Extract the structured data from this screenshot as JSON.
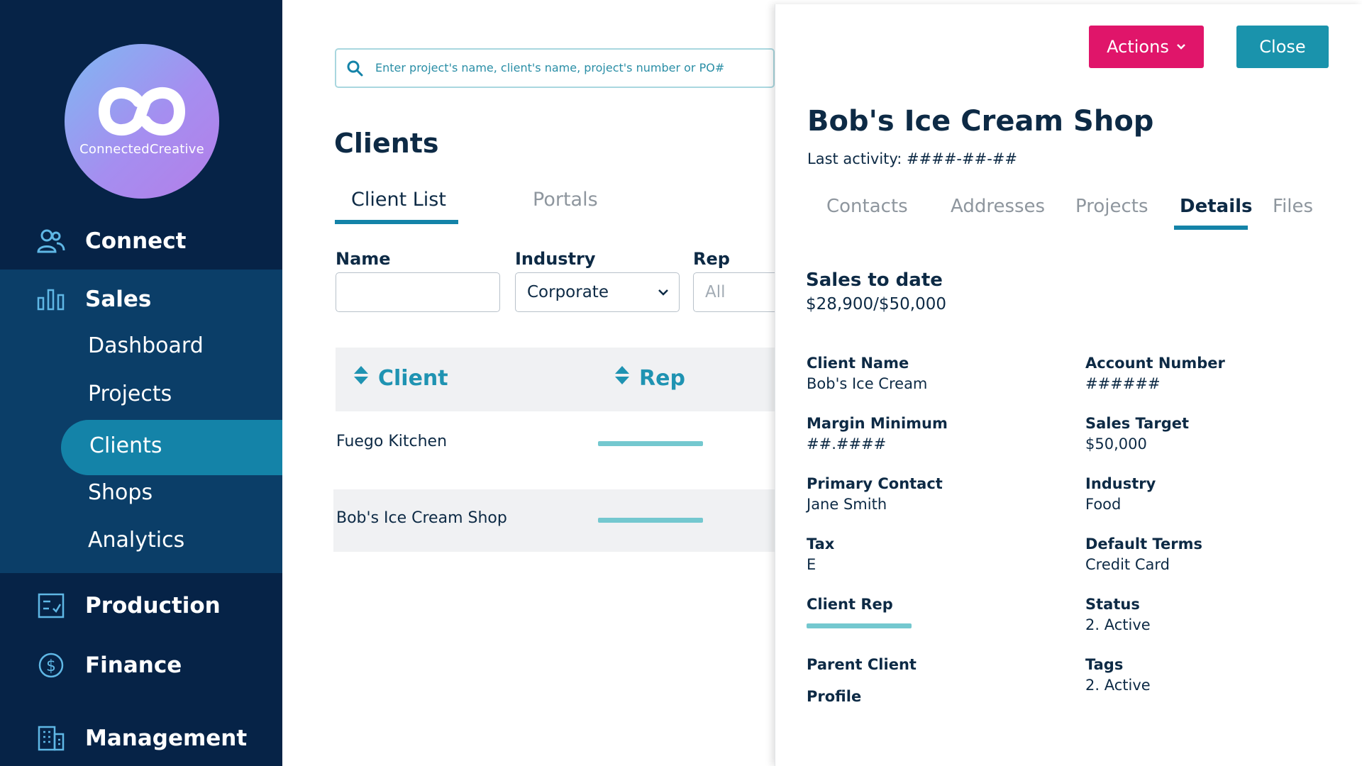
{
  "colors": {
    "sidebar_bg": "#062347",
    "sidebar_section_bg": "#0b3e68",
    "accent_teal": "#1483a8",
    "actions_pink": "#e0156a",
    "close_teal": "#1a93ac",
    "rep_bar": "#74c8cf"
  },
  "brand": {
    "name": "ConnectedCreative"
  },
  "sidebar": {
    "connect": "Connect",
    "sales": "Sales",
    "sales_items": [
      "Dashboard",
      "Projects",
      "Clients",
      "Shops",
      "Analytics"
    ],
    "active_item": "Clients",
    "production": "Production",
    "finance": "Finance",
    "management": "Management"
  },
  "search": {
    "placeholder": "Enter project's name, client's name, project's number or PO#"
  },
  "main": {
    "title": "Clients",
    "tabs": [
      "Client List",
      "Portals"
    ],
    "active_tab": "Client List",
    "filters": {
      "name_label": "Name",
      "name_value": "",
      "industry_label": "Industry",
      "industry_value": "Corporate",
      "rep_label": "Rep",
      "rep_value": "All"
    },
    "table": {
      "columns": [
        "Client",
        "Rep"
      ],
      "rows": [
        {
          "client": "Fuego Kitchen"
        },
        {
          "client": "Bob's Ice Cream Shop"
        }
      ]
    }
  },
  "panel": {
    "actions_label": "Actions",
    "close_label": "Close",
    "title": "Bob's Ice Cream Shop",
    "last_activity": "Last activity: ####-##-##",
    "tabs": [
      "Contacts",
      "Addresses",
      "Projects",
      "Details",
      "Files"
    ],
    "active_tab": "Details",
    "sales_to_date_label": "Sales to date",
    "sales_to_date_value": "$28,900/$50,000",
    "details": {
      "client_name_label": "Client Name",
      "client_name_value": "Bob's Ice Cream",
      "account_number_label": "Account Number",
      "account_number_value": "######",
      "margin_minimum_label": "Margin Minimum",
      "margin_minimum_value": "##.####",
      "sales_target_label": "Sales Target",
      "sales_target_value": "$50,000",
      "primary_contact_label": "Primary Contact",
      "primary_contact_value": "Jane Smith",
      "industry_label": "Industry",
      "industry_value": "Food",
      "tax_label": "Tax",
      "tax_value": "E",
      "default_terms_label": "Default Terms",
      "default_terms_value": "Credit Card",
      "client_rep_label": "Client Rep",
      "status_label": "Status",
      "status_value": "2. Active",
      "parent_client_label": "Parent Client",
      "tags_label": "Tags",
      "tags_value": "2. Active",
      "profile_label": "Profile"
    }
  }
}
